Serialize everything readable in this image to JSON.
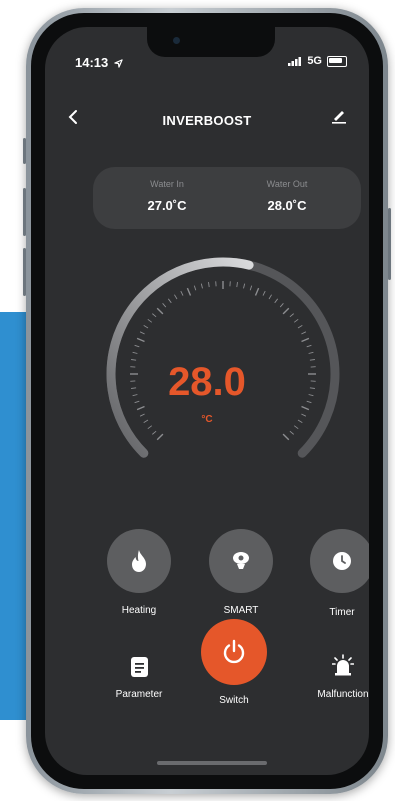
{
  "status_bar": {
    "time": "14:13",
    "network": "5G"
  },
  "header": {
    "title": "INVERBOOST"
  },
  "water": {
    "in_label": "Water In",
    "in_value": "27.0˚C",
    "out_label": "Water Out",
    "out_value": "28.0˚C"
  },
  "thermostat": {
    "value": "28.0",
    "unit": "°C",
    "level_fraction": 0.55
  },
  "modes": [
    {
      "label": "Heating",
      "icon": "flame-icon"
    },
    {
      "label": "SMART",
      "icon": "smart-icon"
    },
    {
      "label": "Timer",
      "icon": "clock-icon"
    }
  ],
  "actions": [
    {
      "label": "Parameter",
      "icon": "document-icon"
    },
    {
      "label": "Switch",
      "icon": "power-icon"
    },
    {
      "label": "Malfunction",
      "icon": "alarm-icon"
    }
  ],
  "colors": {
    "accent": "#e5572a",
    "blue_panel": "#2f8fd0",
    "screen_bg": "#2d2e30"
  }
}
